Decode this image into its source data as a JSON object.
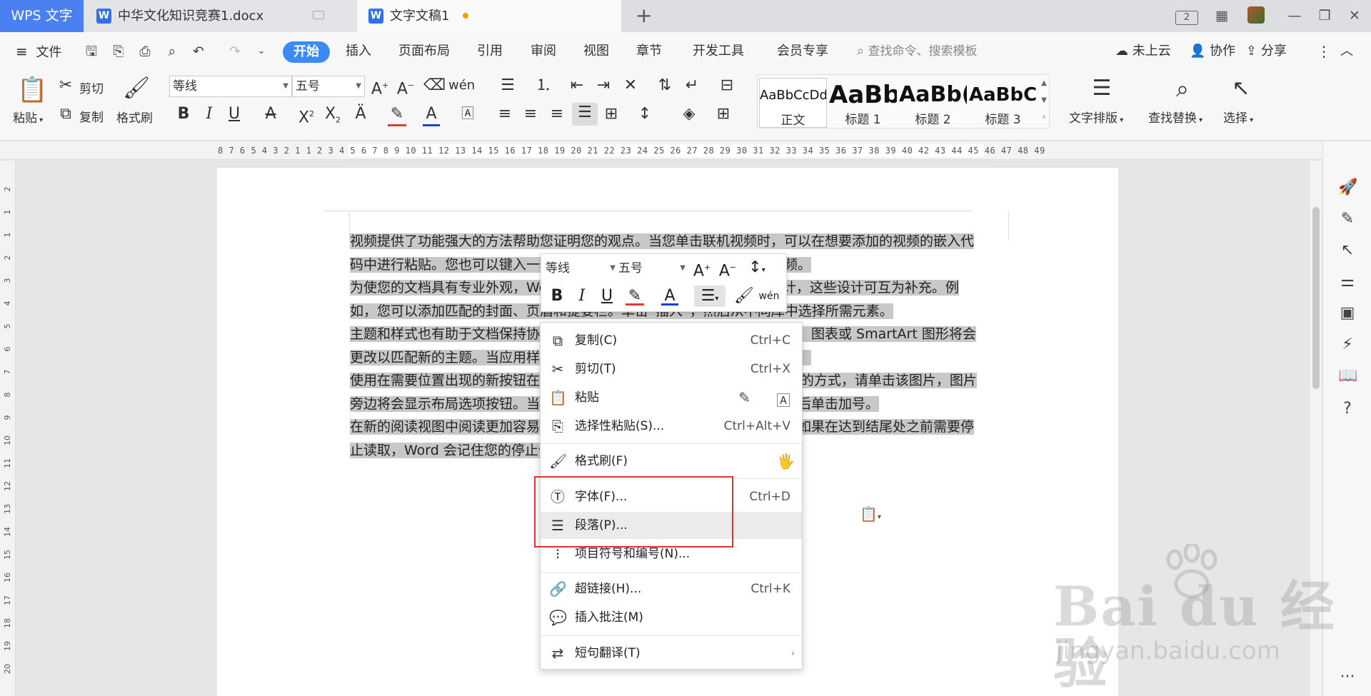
{
  "tabbar": {
    "app_name": "WPS 文字",
    "tabs": [
      {
        "label": "中华文化知识竞赛1.docx"
      },
      {
        "label": "文字文稿1"
      }
    ],
    "add_tab": "+",
    "badge_count": "2"
  },
  "menubar": {
    "file": "文件",
    "tabs": [
      "开始",
      "插入",
      "页面布局",
      "引用",
      "审阅",
      "视图",
      "章节",
      "开发工具",
      "会员专享"
    ],
    "search_placeholder": "查找命令、搜索模板",
    "cloud": "未上云",
    "collab": "协作",
    "share": "分享"
  },
  "ribbon": {
    "paste": "粘贴",
    "cut": "剪切",
    "copy": "复制",
    "format_painter": "格式刷",
    "font_name": "等线",
    "font_size": "五号",
    "phonetic": "wén",
    "styles": [
      {
        "preview": "AaBbCcDd",
        "caption": "正文"
      },
      {
        "preview": "AaBb",
        "caption": "标题 1"
      },
      {
        "preview": "AaBb(",
        "caption": "标题 2"
      },
      {
        "preview": "AaBbC",
        "caption": "标题 3"
      }
    ],
    "text_layout": "文字排版",
    "find_replace": "查找替换",
    "select": "选择"
  },
  "ruler": {
    "numbers": "8 7 6 5 4 3 2 1   1 2 3 4 5 6 7 8 9 10 11 12 13 14 15 16 17 18 19 20 21 22 23 24 25 26 27 28 29 30 31 32 33 34 35 36 37 38 39 40   42 43 44 45 46 47 48 49",
    "vertical": [
      "2",
      "1",
      "",
      "1",
      "2",
      "3",
      "4",
      "5",
      "6",
      "7",
      "8",
      "9",
      "10",
      "11",
      "12",
      "13",
      "14",
      "15",
      "16",
      "17",
      "18",
      "19",
      "20"
    ]
  },
  "document": {
    "paragraphs": [
      "视频提供了功能强大的方法帮助您证明您的观点。当您单击联机视频时，可以在想要添加的视频的嵌入代码中进行粘贴。您也可以键入一个关键字以联机搜索最适合您的文档的视频。",
      "为使您的文档具有专业外观，Word 提供了页眉、页脚、封面和文本框设计，这些设计可互为补充。例如，您可以添加匹配的封面、页眉和提要栏。单击“插入”，然后从不同库中选择所需元素。",
      "主题和样式也有助于文档保持协调。当您单击设计并选择新的主题时，图片、图表或 SmartArt 图形将会更改以匹配新的主题。当应用样式时，您的标题会进行更改以匹配新的主题。",
      "使用在需要位置出现的新按钮在 Word 中保存时间。若要更改图片适应文档的方式，请单击该图片，图片旁边将会显示布局选项按钮。当处理表格时，单击要添加行或列的位置，然后单击加号。",
      "在新的阅读视图中阅读更加容易。可以折叠文档某些部分并关注所需文本。如果在达到结尾处之前需要停止读取，Word 会记住您的停止位置 - 即使在另一个设备上。"
    ]
  },
  "mini_toolbar": {
    "font_name": "等线",
    "font_size": "五号",
    "phonetic": "wén"
  },
  "context_menu": {
    "items": [
      {
        "label": "复制(C)",
        "shortcut": "Ctrl+C"
      },
      {
        "label": "剪切(T)",
        "shortcut": "Ctrl+X"
      },
      {
        "label": "粘贴",
        "shortcut": ""
      },
      {
        "label": "选择性粘贴(S)...",
        "shortcut": "Ctrl+Alt+V"
      },
      {
        "label": "格式刷(F)",
        "shortcut": ""
      },
      {
        "label": "字体(F)...",
        "shortcut": "Ctrl+D"
      },
      {
        "label": "段落(P)...",
        "shortcut": ""
      },
      {
        "label": "项目符号和编号(N)...",
        "shortcut": ""
      },
      {
        "label": "超链接(H)...",
        "shortcut": "Ctrl+K"
      },
      {
        "label": "插入批注(M)",
        "shortcut": ""
      },
      {
        "label": "短句翻译(T)",
        "shortcut": ""
      }
    ]
  },
  "watermark": {
    "logo": "Bai du 经验",
    "url": "jingyan.baidu.com"
  },
  "colors": {
    "accent": "#3d8af7",
    "app_tab": "#4a80f0",
    "selection": "#c8c8c8",
    "highlight_box": "#e0332f"
  }
}
